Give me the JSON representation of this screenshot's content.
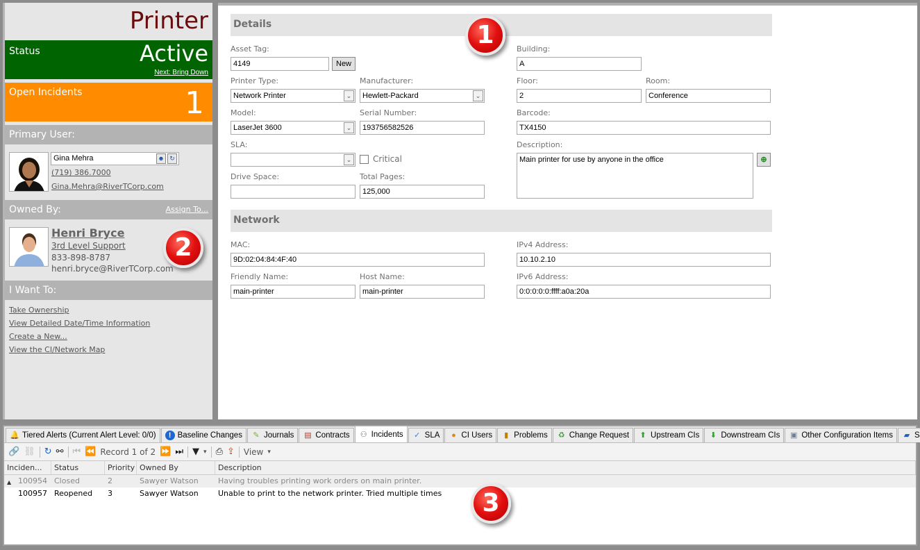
{
  "sidebar": {
    "title": "Printer",
    "status": {
      "label": "Status",
      "value": "Active",
      "next_action": "Next: Bring Down",
      "color": "#006400"
    },
    "open_incidents": {
      "label": "Open Incidents",
      "value": "1",
      "color": "#ff8c00"
    },
    "primary_user": {
      "section_label": "Primary User:",
      "name": "Gina Mehra",
      "phone": "(719) 386.7000",
      "email": "Gina.Mehra@RiverTCorp.com",
      "icons": [
        "select-user-icon",
        "refresh-icon"
      ]
    },
    "owned_by": {
      "section_label": "Owned By:",
      "assign_label": "Assign To...",
      "name": "Henri Bryce",
      "group": "3rd Level Support",
      "phone": "833-898-8787",
      "email": "henri.bryce@RiverTCorp.com"
    },
    "actions": {
      "section_label": "I Want To:",
      "items": [
        "Take Ownership",
        "View Detailed Date/Time Information",
        "Create a New...",
        "View the CI/Network Map"
      ]
    }
  },
  "details": {
    "section_label": "Details",
    "asset_tag": {
      "label": "Asset Tag:",
      "value": "4149",
      "new_button": "New"
    },
    "printer_type": {
      "label": "Printer Type:",
      "value": "Network Printer"
    },
    "manufacturer": {
      "label": "Manufacturer:",
      "value": "Hewlett-Packard"
    },
    "model": {
      "label": "Model:",
      "value": "LaserJet 3600"
    },
    "serial_number": {
      "label": "Serial Number:",
      "value": "193756582526"
    },
    "sla": {
      "label": "SLA:",
      "value": ""
    },
    "critical": {
      "label": "Critical",
      "checked": false
    },
    "drive_space": {
      "label": "Drive Space:",
      "value": ""
    },
    "total_pages": {
      "label": "Total Pages:",
      "value": "125,000"
    },
    "building": {
      "label": "Building:",
      "value": "A"
    },
    "floor": {
      "label": "Floor:",
      "value": "2"
    },
    "room": {
      "label": "Room:",
      "value": "Conference"
    },
    "barcode": {
      "label": "Barcode:",
      "value": "TX4150"
    },
    "description": {
      "label": "Description:",
      "value": "Main printer for use by anyone in the office"
    }
  },
  "network": {
    "section_label": "Network",
    "mac": {
      "label": "MAC:",
      "value": "9D:02:04:84:4F:40"
    },
    "friendly_name": {
      "label": "Friendly Name:",
      "value": "main-printer"
    },
    "host_name": {
      "label": "Host Name:",
      "value": "main-printer"
    },
    "ipv4": {
      "label": "IPv4 Address:",
      "value": "10.10.2.10"
    },
    "ipv6": {
      "label": "IPv6 Address:",
      "value": "0:0:0:0:0:ffff:a0a:20a"
    }
  },
  "callouts": [
    "1",
    "2",
    "3"
  ],
  "bottom": {
    "tabs": [
      {
        "label": "Tiered Alerts (Current Alert Level: 0/0)",
        "icon": "bell-icon"
      },
      {
        "label": "Baseline Changes",
        "icon": "info-icon"
      },
      {
        "label": "Journals",
        "icon": "journal-icon"
      },
      {
        "label": "Contracts",
        "icon": "contract-icon"
      },
      {
        "label": "Incidents",
        "icon": "incident-icon",
        "active": true
      },
      {
        "label": "SLA",
        "icon": "sla-icon"
      },
      {
        "label": "CI Users",
        "icon": "user-icon"
      },
      {
        "label": "Problems",
        "icon": "traffic-light-icon"
      },
      {
        "label": "Change Request",
        "icon": "recycle-icon"
      },
      {
        "label": "Upstream CIs",
        "icon": "arrow-up-icon"
      },
      {
        "label": "Downstream CIs",
        "icon": "arrow-down-icon"
      },
      {
        "label": "Other Configuration Items",
        "icon": "computer-icon"
      },
      {
        "label": "Services",
        "icon": "book-icon"
      }
    ],
    "toolbar": {
      "record_text": "Record 1 of 2",
      "view_label": "View"
    },
    "columns": [
      "Inciden...",
      "Status",
      "Priority",
      "Owned By",
      "Description"
    ],
    "rows": [
      {
        "id": "100954",
        "status": "Closed",
        "priority": "2",
        "owner": "Sawyer Watson",
        "description": "Having troubles printing work orders on main printer."
      },
      {
        "id": "100957",
        "status": "Reopened",
        "priority": "3",
        "owner": "Sawyer Watson",
        "description": "Unable to print to the network printer. Tried multiple times"
      }
    ]
  }
}
